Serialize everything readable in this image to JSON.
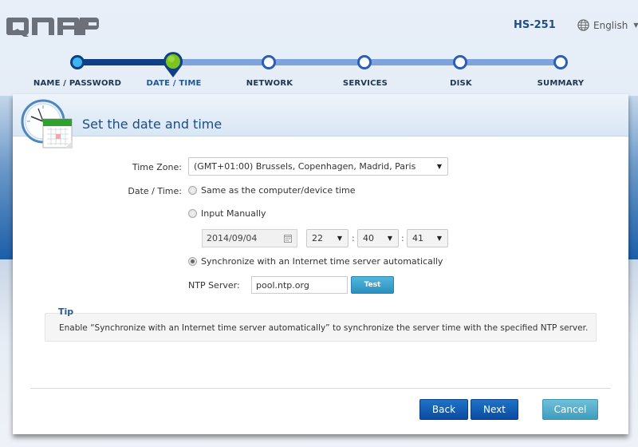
{
  "header": {
    "brand": "QNAP",
    "model": "HS-251",
    "language": "English"
  },
  "stepper": {
    "current_index": 1,
    "steps": [
      {
        "label": "NAME / PASSWORD",
        "state": "done"
      },
      {
        "label": "DATE / TIME",
        "state": "current"
      },
      {
        "label": "NETWORK",
        "state": "todo"
      },
      {
        "label": "SERVICES",
        "state": "todo"
      },
      {
        "label": "DISK",
        "state": "todo"
      },
      {
        "label": "SUMMARY",
        "state": "todo"
      }
    ]
  },
  "page": {
    "title": "Set the date and time"
  },
  "form": {
    "time_zone_label": "Time Zone:",
    "time_zone_value": "(GMT+01:00) Brussels, Copenhagen, Madrid, Paris",
    "date_time_label": "Date / Time:",
    "options": [
      {
        "label": "Same as the computer/device time",
        "checked": false
      },
      {
        "label": "Input Manually",
        "checked": false
      },
      {
        "label": "Synchronize with an Internet time server automatically",
        "checked": true
      }
    ],
    "manual": {
      "date": "2014/09/04",
      "hour": "22",
      "minute": "40",
      "second": "41",
      "separator": ":"
    },
    "ntp_label": "NTP Server:",
    "ntp_value": "pool.ntp.org",
    "test_button": "Test"
  },
  "tip": {
    "title": "Tip",
    "text": "Enable “Synchronize with an Internet time server automatically” to synchronize the server time with the specified NTP server."
  },
  "footer": {
    "back": "Back",
    "next": "Next",
    "cancel": "Cancel"
  },
  "colors": {
    "primary_button": "#0a4ba0",
    "secondary_button": "#3e9dbe",
    "step_done": "#0f3f85",
    "step_todo": "#7ea3dd",
    "step_current": "#7cc520"
  }
}
